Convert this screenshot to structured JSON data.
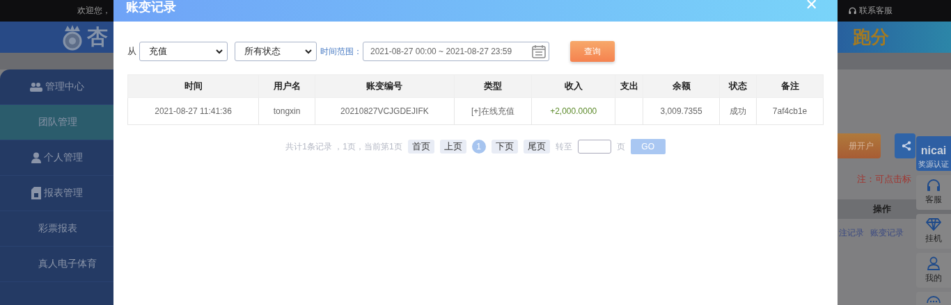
{
  "top_bar": {
    "welcome": "欢迎您，",
    "contact": "联系客服"
  },
  "header": {
    "logo_text": "杏",
    "banner_text": "跑分"
  },
  "sidebar": {
    "items": [
      {
        "label": "管理中心",
        "kind": "group",
        "selected": false,
        "children": [
          {
            "label": "团队管理",
            "selected": true
          }
        ]
      },
      {
        "label": "个人管理",
        "kind": "person",
        "selected": false
      },
      {
        "label": "报表管理",
        "kind": "report",
        "selected": false,
        "children": [
          {
            "label": "彩票报表",
            "selected": false
          },
          {
            "label": "真人电子体育",
            "selected": false
          }
        ]
      }
    ]
  },
  "modal": {
    "title": "账变记录",
    "close": "✕",
    "filter": {
      "from_label": "从",
      "type_select": "充值",
      "status_select": "所有状态",
      "range_label": "时间范围：",
      "range_value": "2021-08-27 00:00 ~ 2021-08-27 23:59",
      "query_button": "查询"
    },
    "table": {
      "columns": [
        {
          "label": "时间",
          "kind": "text"
        },
        {
          "label": "用户名",
          "kind": "text"
        },
        {
          "label": "账变编号",
          "kind": "text"
        },
        {
          "label": "类型",
          "kind": "text"
        },
        {
          "label": "收入",
          "kind": "income"
        },
        {
          "label": "支出",
          "kind": "text"
        },
        {
          "label": "余额",
          "kind": "text"
        },
        {
          "label": "状态",
          "kind": "text"
        },
        {
          "label": "备注",
          "kind": "text"
        }
      ],
      "rows": [
        [
          "2021-08-27 11:41:36",
          "tongxin",
          "20210827VCJGDEJIFK",
          "[+]在线充值",
          "+2,000.0000",
          "",
          "3,009.7355",
          "成功",
          "7af4cb1e"
        ]
      ]
    },
    "pagination": {
      "summary": "共计1条记录 ，1页，当前第1页",
      "first": "首页",
      "prev": "上页",
      "pages": [
        {
          "label": "1",
          "selected": true
        }
      ],
      "next": "下页",
      "last": "尾页",
      "goto_label": "转至",
      "page_suffix": "页",
      "go": "GO"
    }
  },
  "background_page": {
    "buttons": [
      {
        "label": "册开户",
        "kind": "register"
      },
      {
        "kind": "share"
      }
    ],
    "note": "注：可点击标",
    "table_header": "操作",
    "links": [
      "注记录",
      "账变记录"
    ]
  },
  "floating_bar": [
    {
      "kind": "brand",
      "brand": "nicai",
      "label": "奖源认证"
    },
    {
      "kind": "headset",
      "label": "客服"
    },
    {
      "kind": "diamond",
      "label": "挂机"
    },
    {
      "kind": "user",
      "label": "我的"
    },
    {
      "kind": "chat"
    }
  ]
}
